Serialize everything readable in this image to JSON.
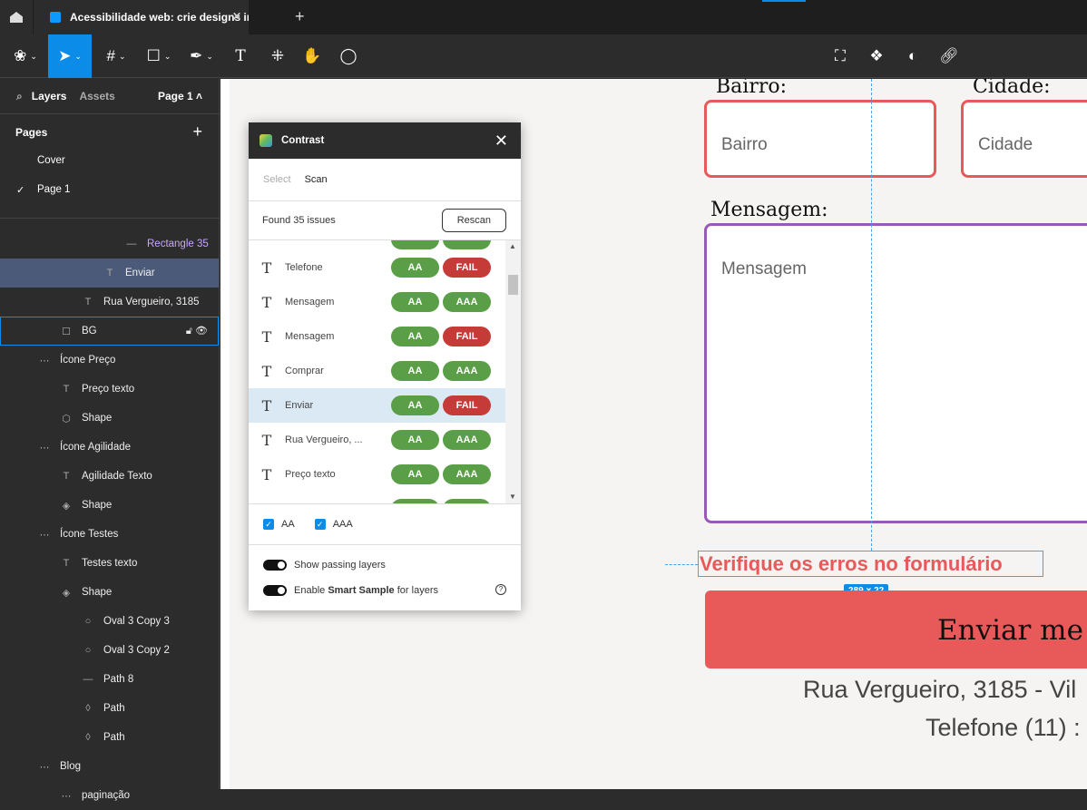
{
  "tabbar": {
    "tab_title": "Acessibilidade web: crie designs inclusi",
    "close": "✕",
    "new_tab": "+"
  },
  "toolbar": {
    "tools": [
      "main-menu",
      "move",
      "frame",
      "rectangle",
      "pen",
      "text",
      "resources",
      "hand",
      "comment"
    ],
    "right": [
      "crop",
      "components",
      "contrast",
      "link"
    ]
  },
  "left_panel": {
    "layers_tab": "Layers",
    "assets_tab": "Assets",
    "page_selector": "Page 1 ˄",
    "pages_title": "Pages",
    "add": "+",
    "pages": [
      {
        "label": "Cover"
      },
      {
        "label": "Page 1",
        "check": "✓"
      }
    ],
    "layers": [
      {
        "label": "Rectangle 35",
        "icon": "—",
        "indent": 138,
        "accent": true
      },
      {
        "label": "Enviar",
        "icon": "T",
        "indent": 114,
        "selected": true
      },
      {
        "label": "Rua Vergueiro, 3185",
        "icon": "T",
        "indent": 90
      },
      {
        "label": "BG",
        "icon": "☐",
        "indent": 66,
        "hover": true
      },
      {
        "label": "Ícone Preço",
        "icon": "⋯",
        "indent": 42
      },
      {
        "label": "Preço texto",
        "icon": "T",
        "indent": 66
      },
      {
        "label": "Shape",
        "icon": "⬡",
        "indent": 66
      },
      {
        "label": "Ícone Agilidade",
        "icon": "⋯",
        "indent": 42
      },
      {
        "label": "Agilidade Texto",
        "icon": "T",
        "indent": 66
      },
      {
        "label": "Shape",
        "icon": "◈",
        "indent": 66
      },
      {
        "label": "Ícone Testes",
        "icon": "⋯",
        "indent": 42
      },
      {
        "label": "Testes texto",
        "icon": "T",
        "indent": 66
      },
      {
        "label": "Shape",
        "icon": "◈",
        "indent": 66
      },
      {
        "label": "Oval 3 Copy 3",
        "icon": "○",
        "indent": 90
      },
      {
        "label": "Oval 3 Copy 2",
        "icon": "○",
        "indent": 90
      },
      {
        "label": "Path 8",
        "icon": "—",
        "indent": 90
      },
      {
        "label": "Path",
        "icon": "◊",
        "indent": 90
      },
      {
        "label": "Path",
        "icon": "◊",
        "indent": 90
      },
      {
        "label": "Blog",
        "icon": "⋯",
        "indent": 42
      },
      {
        "label": "paginação",
        "icon": "⋯",
        "indent": 66
      }
    ]
  },
  "plugin": {
    "title": "Contrast",
    "close": "✕",
    "tabs": [
      "Select",
      "Scan"
    ],
    "found": "Found 35 issues",
    "rescan": "Rescan",
    "results": [
      {
        "name": "Telefone",
        "aa": "AA",
        "aaa": "FAIL"
      },
      {
        "name": "Mensagem",
        "aa": "AA",
        "aaa": "AAA"
      },
      {
        "name": "Mensagem",
        "aa": "AA",
        "aaa": "FAIL"
      },
      {
        "name": "Comprar",
        "aa": "AA",
        "aaa": "AAA"
      },
      {
        "name": "Enviar",
        "aa": "AA",
        "aaa": "FAIL",
        "selected": true
      },
      {
        "name": "Rua Vergueiro, ...",
        "aa": "AA",
        "aaa": "AAA"
      },
      {
        "name": "Preço texto",
        "aa": "AA",
        "aaa": "AAA"
      }
    ],
    "filter_aa": "AA",
    "filter_aaa": "AAA",
    "show_passing": "Show passing layers",
    "smart_pre": "Enable ",
    "smart_bold": "Smart Sample",
    "smart_post": " for layers",
    "help": "?"
  },
  "canvas": {
    "bairro_label": "Bairro:",
    "bairro_ph": "Bairro",
    "cidade_label": "Cidade:",
    "cidade_ph": "Cidade",
    "mensagem_label": "Mensagem:",
    "mensagem_ph": "Mensagem",
    "error": "Verifique os erros no formulário",
    "dimensions": "289 × 22",
    "submit": "Enviar me",
    "address": "Rua Vergueiro, 3185 - Vil",
    "phone": "Telefone (11) :"
  },
  "colors": {
    "accent": "#0c8ce9",
    "error": "#e85a5a",
    "fail": "#c53b37",
    "pass": "#5a9e47",
    "textarea_border": "#9b59b6"
  }
}
